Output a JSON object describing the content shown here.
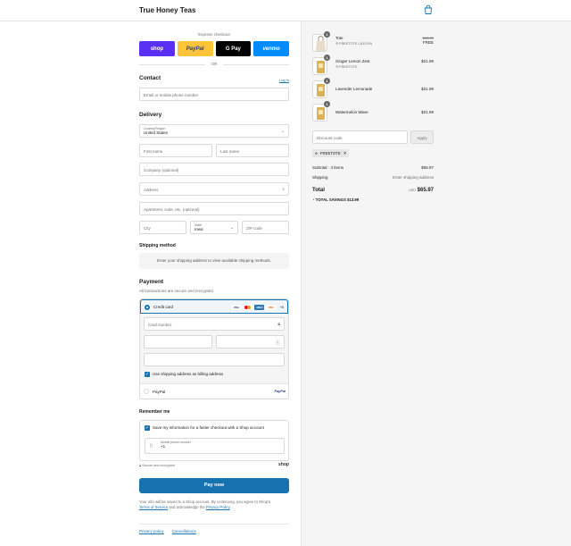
{
  "header": {
    "brand": "True Honey Teas",
    "cart_icon": "shopping-bag-icon"
  },
  "express": {
    "label": "Express checkout",
    "buttons": [
      {
        "label": "shop",
        "bg": "#5a31f4",
        "fg": "#ffffff"
      },
      {
        "label": "PayPal",
        "bg": "#ffc439",
        "fg": "#253b80"
      },
      {
        "label": "G Pay",
        "bg": "#000000",
        "fg": "#ffffff"
      },
      {
        "label": "venmo",
        "bg": "#008cff",
        "fg": "#ffffff"
      }
    ],
    "or": "OR"
  },
  "contact": {
    "title": "Contact",
    "login": "Log in",
    "placeholder": "Email or mobile phone number"
  },
  "delivery": {
    "title": "Delivery",
    "country_label": "Country/Region",
    "country_value": "United States",
    "first_name": "First name",
    "last_name": "Last name",
    "company": "Company (optional)",
    "address": "Address",
    "apartment": "Apartment, suite, etc. (optional)",
    "city": "City",
    "state_label": "State",
    "state_value": "Iowa",
    "zip": "ZIP code"
  },
  "shipping_method": {
    "title": "Shipping method",
    "message": "Enter your shipping address to view available shipping methods."
  },
  "payment": {
    "title": "Payment",
    "subtitle": "All transactions are secure and encrypted.",
    "credit_card": "Credit card",
    "card_brands": [
      "VISA",
      "MC",
      "AMEX",
      "DISC"
    ],
    "more_cards": "+5",
    "card_number": "Card number",
    "billing_checkbox": "Use shipping address as billing address",
    "paypal": "PayPal",
    "paypal_logo": "PayPal"
  },
  "remember": {
    "title": "Remember me",
    "checkbox": "Save my information for a faster checkout with a Shop account",
    "phone_label": "Mobile phone number",
    "phone_value": "+1",
    "secure": "Secure and encrypted",
    "shop": "shop"
  },
  "pay_now": "Pay now",
  "legal": {
    "text": "Your info will be saved to a Shop account. By continuing, you agree to Shop's",
    "terms": "Terms of Service",
    "and": "and acknowledge the",
    "privacy": "Privacy Policy",
    "end": "."
  },
  "footer": {
    "privacy": "Privacy policy",
    "cancellations": "Cancellations"
  },
  "order": {
    "items": [
      {
        "name": "Tote",
        "sub": "FREETOTE (-$13.99)",
        "old_price": "$13.99",
        "price": "FREE",
        "qty": "1"
      },
      {
        "name": "Ginger Lemon Zest",
        "sub": "FREETOTE",
        "price": "$21.99",
        "qty": "1"
      },
      {
        "name": "Lavender Lemonade",
        "sub": "",
        "price": "$21.99",
        "qty": "1"
      },
      {
        "name": "Watermelon Wave",
        "sub": "",
        "price": "$21.99",
        "qty": "1"
      }
    ],
    "discount_placeholder": "Discount code",
    "apply": "Apply",
    "code": "FREETOTE",
    "subtotal_label": "Subtotal · 4 items",
    "subtotal": "$65.97",
    "shipping_label": "Shipping",
    "shipping": "Enter shipping address",
    "total_label": "Total",
    "currency": "USD",
    "total": "$65.97",
    "savings_label": "TOTAL SAVINGS",
    "savings": "$13.99"
  },
  "colors": {
    "accent": "#1773b0"
  }
}
